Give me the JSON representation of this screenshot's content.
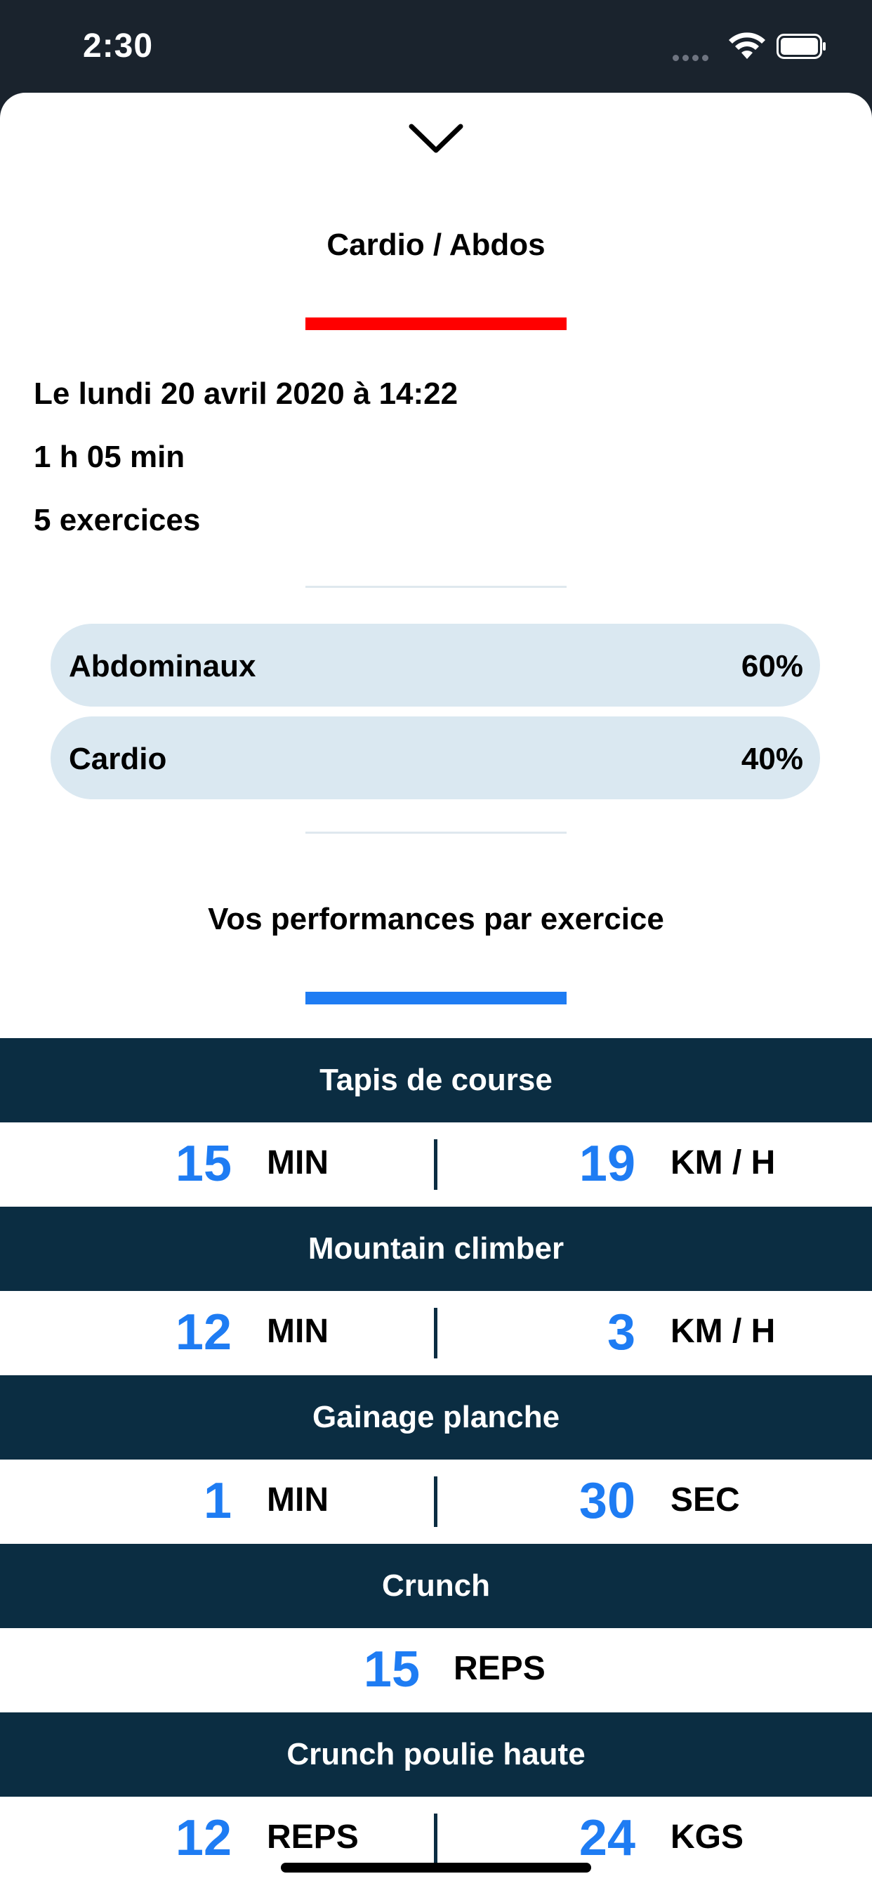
{
  "status_bar": {
    "time": "2:30"
  },
  "sheet": {
    "title": "Cardio / Abdos",
    "date": "Le lundi 20 avril 2020 à 14:22",
    "duration": "1 h 05 min",
    "exercise_count": "5 exercices",
    "categories": [
      {
        "name": "Abdominaux",
        "percent": "60%"
      },
      {
        "name": "Cardio",
        "percent": "40%"
      }
    ],
    "performance_title": "Vos performances par exercice",
    "exercises": [
      {
        "name": "Tapis de course",
        "value1": "15",
        "unit1": "MIN",
        "value2": "19",
        "unit2": "KM / H"
      },
      {
        "name": "Mountain climber",
        "value1": "12",
        "unit1": "MIN",
        "value2": "3",
        "unit2": "KM / H"
      },
      {
        "name": "Gainage planche",
        "value1": "1",
        "unit1": "MIN",
        "value2": "30",
        "unit2": "SEC"
      },
      {
        "name": "Crunch",
        "value1": "15",
        "unit1": "REPS"
      },
      {
        "name": "Crunch poulie haute",
        "value1": "12",
        "unit1": "REPS",
        "value2": "24",
        "unit2": "KGS"
      }
    ]
  },
  "colors": {
    "status_bar_bg": "#1a232d",
    "title_accent": "#ff0000",
    "performance_accent": "#1e7cf3",
    "exercise_header_bg": "#0b2d42",
    "category_pill_bg": "#dae8f1",
    "value_blue": "#1e7cf3"
  },
  "icons": {
    "close": "chevron-down-icon",
    "wifi": "wifi-icon",
    "battery": "battery-icon",
    "signal": "signal-icon"
  }
}
